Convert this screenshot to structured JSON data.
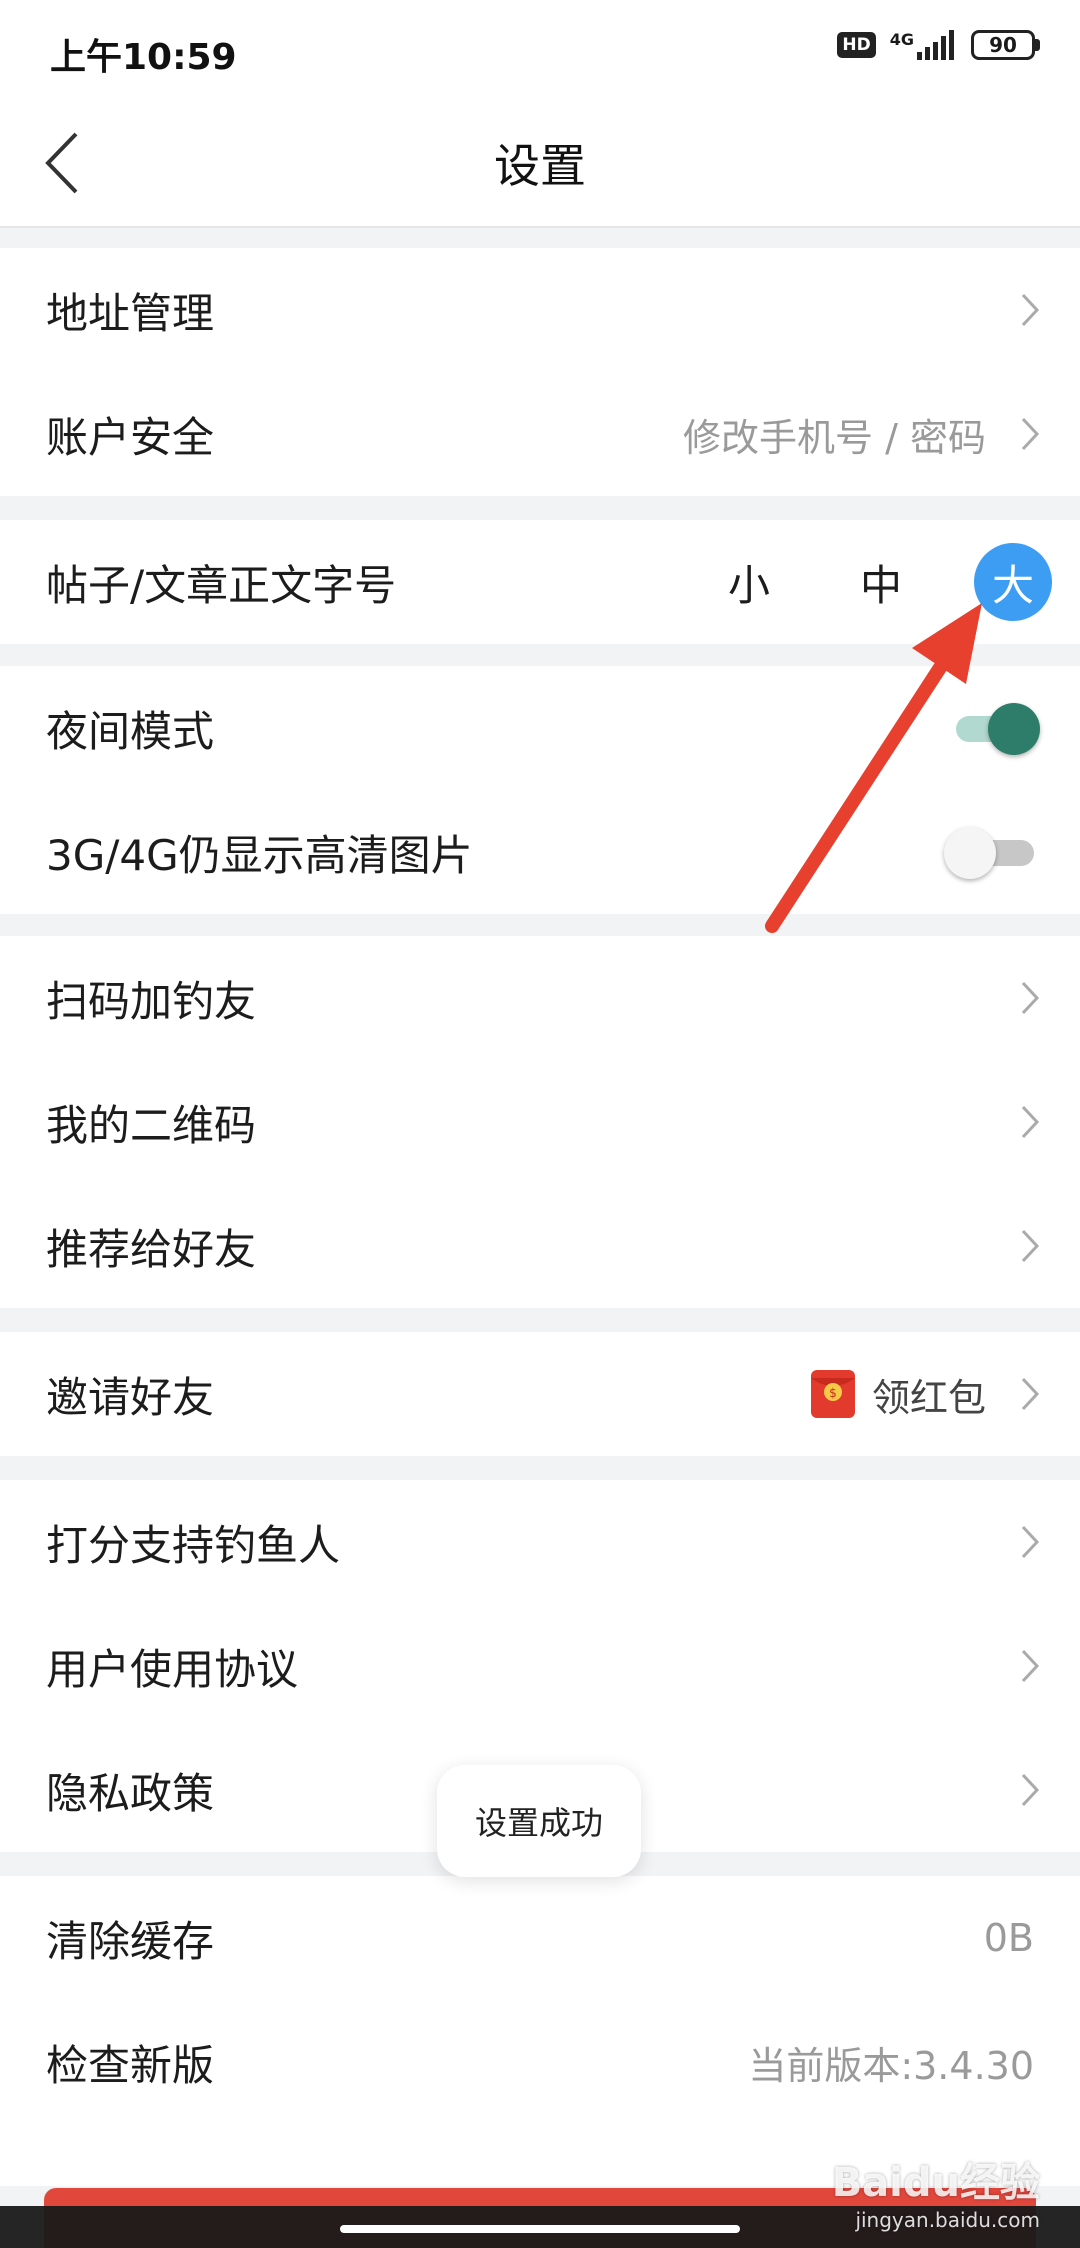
{
  "status_bar": {
    "time": "上午10:59",
    "hd": "HD",
    "network": "4G",
    "battery": "90"
  },
  "header": {
    "title": "设置",
    "back_icon": "chevron-left-icon"
  },
  "groups": {
    "account": [
      {
        "label": "地址管理",
        "value": ""
      },
      {
        "label": "账户安全",
        "value": "修改手机号 / 密码"
      }
    ],
    "font_size": {
      "label": "帖子/文章正文字号",
      "options": [
        "小",
        "中",
        "大"
      ],
      "selected": "大"
    },
    "display": {
      "night_mode": {
        "label": "夜间模式",
        "on": true
      },
      "hd_images": {
        "label": "3G/4G仍显示高清图片",
        "on": false
      }
    },
    "social": [
      {
        "label": "扫码加钓友"
      },
      {
        "label": "我的二维码"
      },
      {
        "label": "推荐给好友"
      }
    ],
    "invite": {
      "label": "邀请好友",
      "value": "领红包",
      "icon": "red-packet-icon"
    },
    "about": [
      {
        "label": "打分支持钓鱼人"
      },
      {
        "label": "用户使用协议"
      },
      {
        "label": "隐私政策"
      }
    ],
    "storage": {
      "clear_cache": {
        "label": "清除缓存",
        "value": "0B"
      },
      "check_update": {
        "label": "检查新版",
        "value": "当前版本:3.4.30"
      }
    }
  },
  "toast": "设置成功",
  "watermark": {
    "brand": "Baidu经验",
    "url": "jingyan.baidu.com"
  },
  "colors": {
    "accent_blue": "#3d9df2",
    "toggle_on": "#2e7d6b",
    "logout_red": "#e2473c",
    "annotation_red": "#e8402f"
  }
}
